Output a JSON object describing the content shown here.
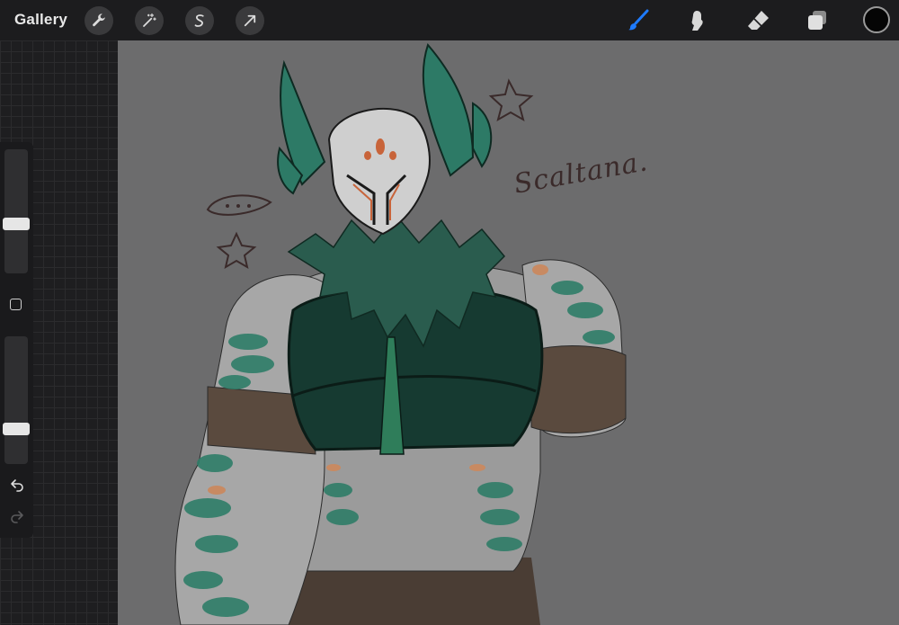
{
  "topbar": {
    "gallery_label": "Gallery",
    "left_tools": [
      "wrench-icon",
      "magic-wand-icon",
      "selection-s-icon",
      "transform-arrow-icon"
    ],
    "right_tools": [
      "brush-icon",
      "smudge-icon",
      "eraser-icon",
      "layers-icon"
    ],
    "active_tool": "brush-icon",
    "accent_color": "#1e7bff",
    "current_color": "#050505"
  },
  "sidebar": {
    "brush_size_level": 0.62,
    "opacity_level": 0.72
  },
  "canvas": {
    "signature_text": "Scaltana."
  }
}
